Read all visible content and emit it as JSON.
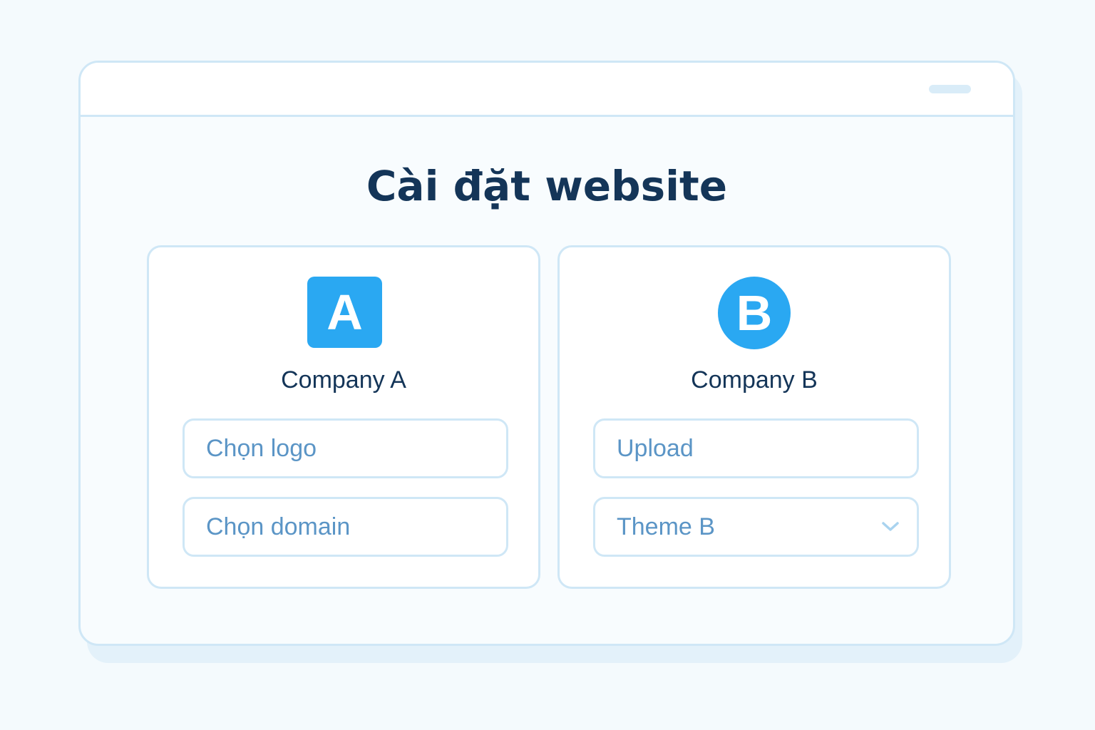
{
  "page": {
    "title": "Cài đặt website"
  },
  "companies": [
    {
      "logo_letter": "A",
      "name": "Company A",
      "field1": "Chọn logo",
      "field2": "Chọn domain"
    },
    {
      "logo_letter": "B",
      "name": "Company B",
      "field1": "Upload",
      "field2": "Theme B"
    }
  ],
  "colors": {
    "accent": "#2aa8f2",
    "title": "#143558",
    "border": "#cfe7f6",
    "placeholder": "#5b95c6"
  },
  "icons": {
    "dropdown": "chevron-down-icon"
  }
}
